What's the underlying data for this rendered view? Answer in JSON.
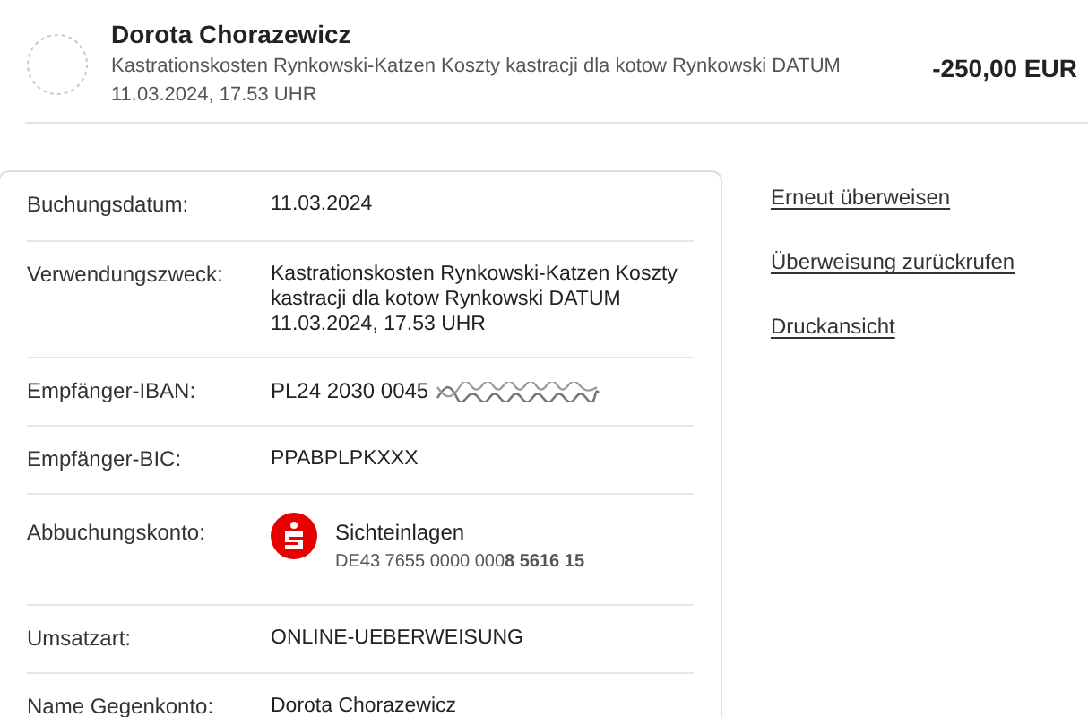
{
  "transaction": {
    "name": "Dorota Chorazewicz",
    "purpose": "Kastrationskosten Rynkowski-Katzen Koszty kastracji dla kotow Rynkowski DATUM",
    "datetime": "11.03.2024, 17.53 UHR",
    "amount": "-250,00 EUR"
  },
  "details": [
    {
      "kind": "text",
      "label": "Buchungsdatum:",
      "value": "11.03.2024"
    },
    {
      "kind": "text",
      "label": "Verwendungszweck:",
      "value": "Kastrationskosten Rynkowski-Katzen Koszty kastracji dla kotow Rynkowski DATUM 11.03.2024, 17.53 UHR"
    },
    {
      "kind": "redacted",
      "label": "Empfänger-IBAN:",
      "value": "PL24 2030 0045"
    },
    {
      "kind": "text",
      "label": "Empfänger-BIC:",
      "value": "PPABPLPKXXX"
    },
    {
      "kind": "account",
      "label": "Abbuchungskonto:",
      "value": "Sichteinlagen",
      "sub": "DE43 7655 0000 000**8 5616 15**"
    },
    {
      "kind": "text",
      "label": "Umsatzart:",
      "value": "ONLINE-UEBERWEISUNG"
    },
    {
      "kind": "text",
      "label": "Name Gegenkonto:",
      "value": "Dorota Chorazewicz"
    }
  ],
  "actions": [
    "Erneut überweisen",
    "Überweisung zurückrufen",
    "Druckansicht"
  ]
}
